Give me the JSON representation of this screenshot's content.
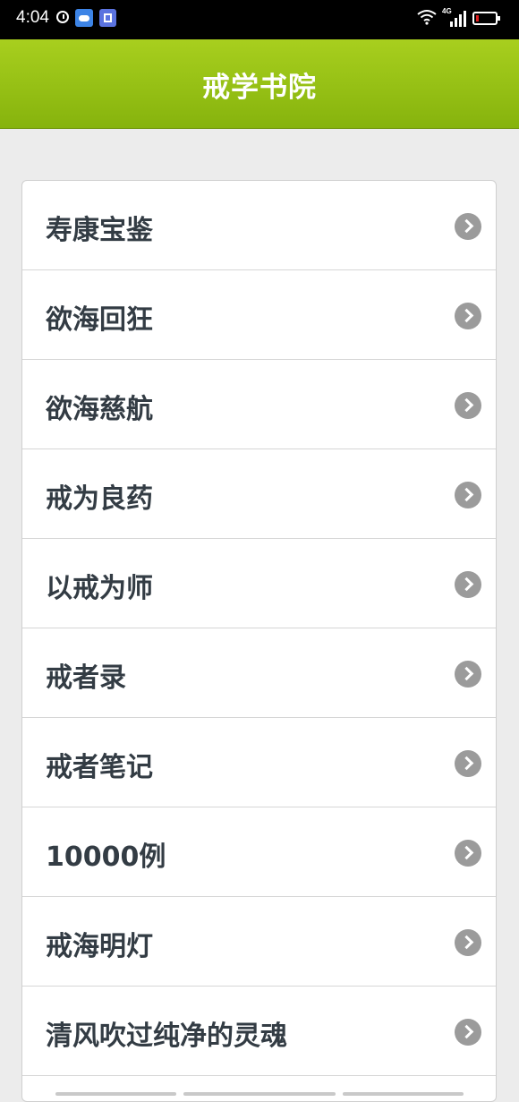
{
  "status_bar": {
    "time": "4:04",
    "network": "4G"
  },
  "header": {
    "title": "戒学书院"
  },
  "list": {
    "items": [
      {
        "label": "寿康宝鉴"
      },
      {
        "label": "欲海回狂"
      },
      {
        "label": "欲海慈航"
      },
      {
        "label": "戒为良药"
      },
      {
        "label": "以戒为师"
      },
      {
        "label": "戒者录"
      },
      {
        "label": "戒者笔记"
      },
      {
        "label": "10000例"
      },
      {
        "label": "戒海明灯"
      },
      {
        "label": "清风吹过纯净的灵魂"
      }
    ]
  },
  "icons": {
    "status": [
      "alarm-icon",
      "cloud-app-icon",
      "notes-app-icon",
      "wifi-icon",
      "signal-icon",
      "battery-icon"
    ],
    "list_item": "chevron-right-icon"
  },
  "colors": {
    "header_bg": "#98c318",
    "page_bg": "#ececec",
    "item_text": "#333c44",
    "chevron": "#9b9b9b"
  }
}
